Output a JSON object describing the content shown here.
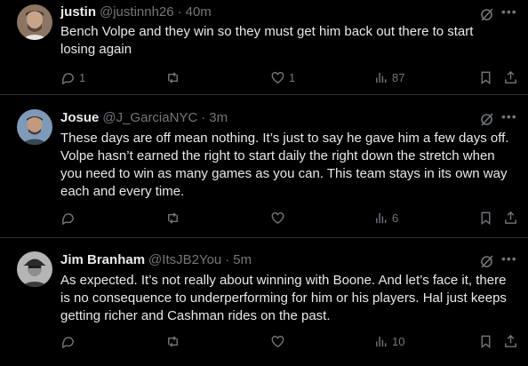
{
  "tweets": [
    {
      "name": "justin",
      "handle": "@justinnh26",
      "separator": "·",
      "time": "40m",
      "text": "Bench Volpe and they win so they must get him back out there to start losing again",
      "replies": "1",
      "retweets": "",
      "likes": "1",
      "views": "87",
      "avatar_color": "#6b5446"
    },
    {
      "name": "Josue",
      "handle": "@J_GarciaNYC",
      "separator": "·",
      "time": "3m",
      "text": "These days are off mean nothing. It’s just to say he gave him a few days off. Volpe hasn’t earned the right to start daily the right down the stretch when you need to win as many games as you can. This team stays in its own way each and every time.",
      "replies": "",
      "retweets": "",
      "likes": "",
      "views": "6",
      "avatar_color": "#4f6a87"
    },
    {
      "name": "Jim Branham",
      "handle": "@ItsJB2You",
      "separator": "·",
      "time": "5m",
      "text": "As expected. It’s not really about winning with Boone. And let’s face it, there is no consequence to underperforming for him or his players. Hal just keeps getting richer and Cashman rides on the past.",
      "replies": "",
      "retweets": "",
      "likes": "",
      "views": "10",
      "avatar_color": "#8a8a8a"
    }
  ],
  "colors": {
    "background": "#000000",
    "text": "#e7e9ea",
    "muted": "#71767b",
    "divider": "#2f3336"
  },
  "icons": [
    "grok-icon",
    "more-icon",
    "reply-icon",
    "retweet-icon",
    "like-icon",
    "views-icon",
    "bookmark-icon",
    "share-icon"
  ]
}
